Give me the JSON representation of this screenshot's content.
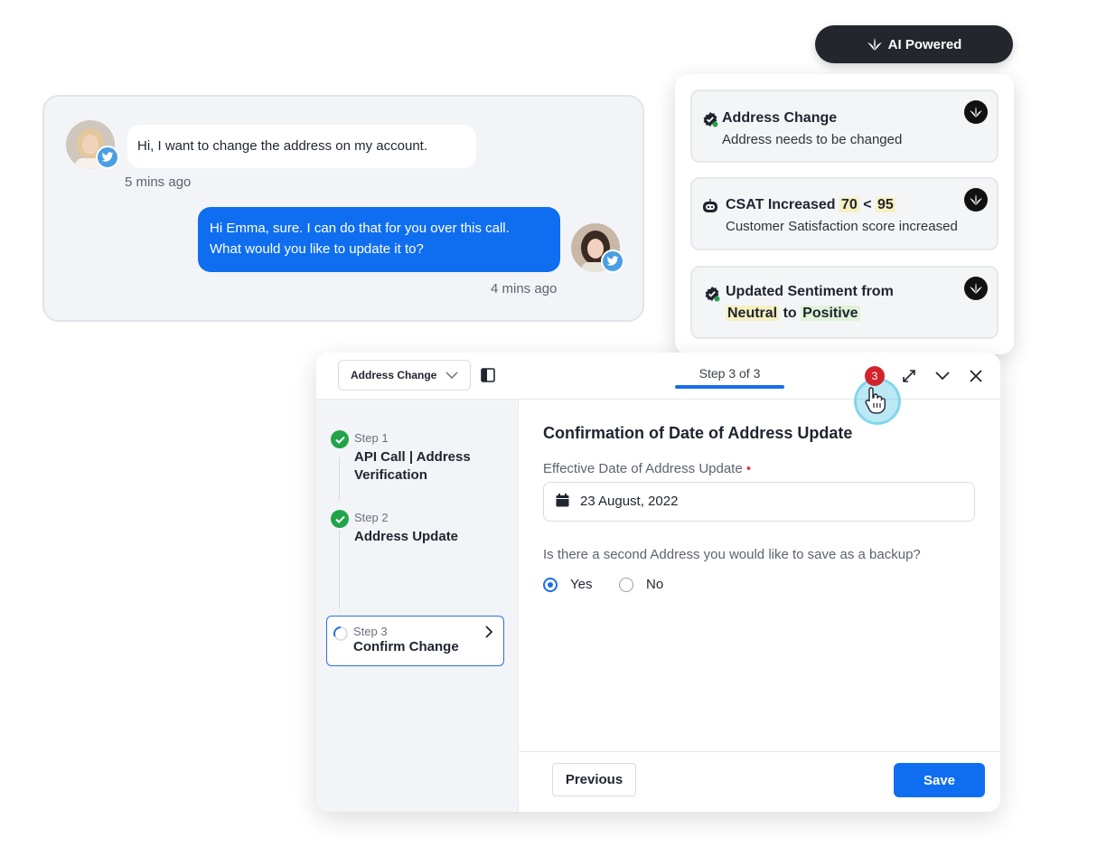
{
  "ai_badge": {
    "label": "AI Powered",
    "icon": "sprinklr-logo-icon"
  },
  "chat": {
    "incoming": {
      "text": "Hi, I want to change the address on my account.",
      "time": "5 mins ago",
      "channel_icon": "twitter-icon"
    },
    "outgoing": {
      "line1": "Hi Emma, sure. I can do that for you over this call.",
      "line2": "What would you like to update it to?",
      "time": "4 mins ago",
      "channel_icon": "twitter-icon"
    }
  },
  "insights": [
    {
      "title": "Address Change",
      "subtitle": "Address needs to be changed",
      "icon": "verified-check-icon"
    },
    {
      "title": "CSAT Increased",
      "from": "70",
      "op": "<",
      "to": "95",
      "subtitle": "Customer Satisfaction score increased",
      "icon": "robot-icon"
    },
    {
      "title": "Updated Sentiment from",
      "from": "Neutral",
      "joiner": "to",
      "to": "Positive",
      "icon": "verified-check-icon"
    }
  ],
  "panel": {
    "dropdown": "Address Change",
    "step_tab": "Step 3 of 3",
    "notification_count": "3",
    "steps": [
      {
        "label": "Step 1",
        "name1": "API Call | Address",
        "name2": "Verification",
        "status": "done"
      },
      {
        "label": "Step 2",
        "name1": "Address Update",
        "status": "done"
      },
      {
        "label": "Step 3",
        "name1": "Confirm Change",
        "status": "active"
      }
    ],
    "form": {
      "title": "Confirmation of Date of Address Update",
      "date_label": "Effective Date of Address Update",
      "required_mark": "•",
      "date_value": "23 August, 2022",
      "question": "Is there a second Address you would like to save as a backup?",
      "options": [
        "Yes",
        "No"
      ],
      "selected": "Yes"
    },
    "buttons": {
      "previous": "Previous",
      "save": "Save"
    }
  },
  "colors": {
    "primary": "#0f6ef0",
    "success": "#21a34a",
    "badge": "#d2232a",
    "dark": "#23262d"
  }
}
